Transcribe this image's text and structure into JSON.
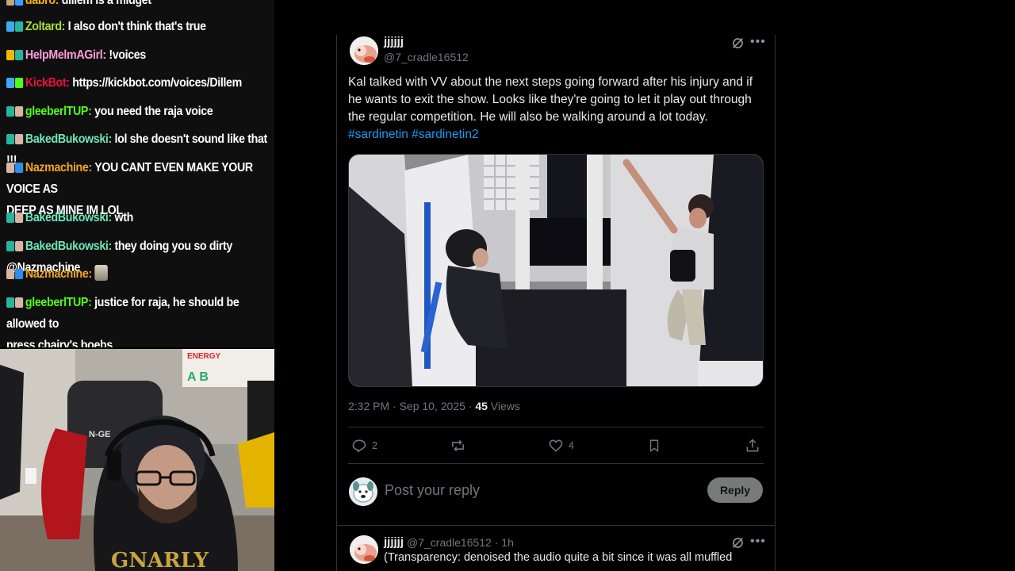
{
  "chat": {
    "partial_top": {
      "user": "dabro:",
      "msg": "dillem is a midget"
    },
    "messages": [
      {
        "user": "Zoltard:",
        "msg": "I also don't think that's true",
        "color": "#a6e22e",
        "badges": [
          "sword",
          "bits"
        ]
      },
      {
        "user": "HelpMelmAGirl:",
        "msg": "!voices",
        "color": "#ff9cd9",
        "badges": [
          "crown",
          "bits"
        ]
      },
      {
        "user": "KickBot:",
        "msg": "https://kickbot.com/voices/Dillem",
        "color": "#e9113c",
        "badges": [
          "sword",
          "verified"
        ]
      },
      {
        "user": "gleeberlTUP:",
        "msg": "you need the raja voice",
        "color": "#53fc18",
        "badges": [
          "bits",
          "gift"
        ]
      },
      {
        "user": "BakedBukowski:",
        "msg": "lol she doesn't sound like that !!!",
        "color": "#6ee7b7",
        "badges": [
          "bits",
          "gift"
        ]
      },
      {
        "user": "Nazmachine:",
        "msg": "YOU CANT EVEN MAKE YOUR VOICE AS",
        "msg2": "DEEP AS MINE IM LOL",
        "color": "#f6a623",
        "badges": [
          "gift",
          "diamond"
        ]
      },
      {
        "user": "BakedBukowski:",
        "msg": "wth",
        "color": "#6ee7b7",
        "badges": [
          "bits",
          "gift"
        ]
      },
      {
        "user": "BakedBukowski:",
        "msg": "they doing you so dirty @Nazmachine",
        "color": "#6ee7b7",
        "badges": [
          "bits",
          "gift"
        ]
      },
      {
        "user": "Nazmachine:",
        "msg": "",
        "color": "#f6a623",
        "badges": [
          "gift",
          "diamond"
        ],
        "emote": "dog-emote"
      },
      {
        "user": "gleeberlTUP:",
        "msg": "justice for raja, he should be allowed to",
        "msg2": "press chairy's boebs",
        "color": "#53fc18",
        "badges": [
          "bits",
          "gift"
        ]
      }
    ]
  },
  "webcam": {
    "chair_brand": "N-GE",
    "poster_letters": "A B",
    "poster_word": "ENERGY"
  },
  "tweet": {
    "name": "jjjjjj",
    "handle": "@7_cradle16512",
    "text": "Kal talked with VV about the next steps going forward after his injury and if he wants to exit the show. Looks like they're going to let it play out through the regular competition. He will also be walking around a lot today. ",
    "hashtags": [
      "#sardinetin",
      "#sardinetin2"
    ],
    "time": "2:32 PM · Sep 10, 2025 · ",
    "views_count": "45",
    "views_label": " Views",
    "stats": {
      "replies": "2",
      "reposts": "",
      "likes": "4"
    }
  },
  "reply_box": {
    "placeholder": "Post your reply",
    "button": "Reply"
  },
  "reply": {
    "name": "jjjjjj",
    "handle": "@7_cradle16512 · 1h",
    "text": "(Transparency: denoised the audio quite a bit since it was all muffled"
  },
  "colors": {
    "hashtag": "#1d9bf0",
    "text": "#e7e9ea",
    "muted": "#71767b",
    "border": "#2f3336"
  }
}
